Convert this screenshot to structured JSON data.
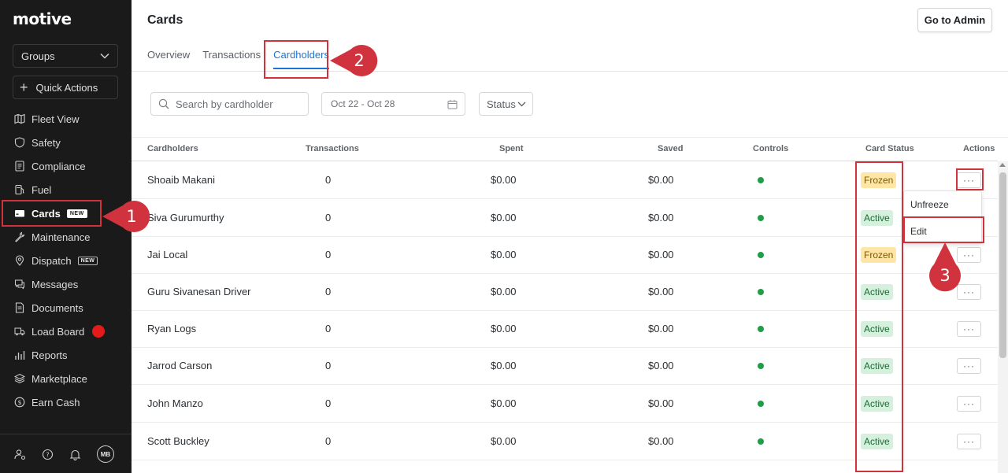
{
  "sidebar": {
    "logo": "motive",
    "groups_label": "Groups",
    "quick_actions_label": "Quick Actions",
    "items": [
      {
        "label": "Fleet View",
        "icon": "map-icon"
      },
      {
        "label": "Safety",
        "icon": "shield-icon"
      },
      {
        "label": "Compliance",
        "icon": "document-icon"
      },
      {
        "label": "Fuel",
        "icon": "fuel-icon"
      },
      {
        "label": "Cards",
        "icon": "card-icon",
        "badge": "NEW",
        "active": true
      },
      {
        "label": "Maintenance",
        "icon": "wrench-icon"
      },
      {
        "label": "Dispatch",
        "icon": "location-pin-icon",
        "badge": "NEW"
      },
      {
        "label": "Messages",
        "icon": "chat-icon"
      },
      {
        "label": "Documents",
        "icon": "file-icon"
      },
      {
        "label": "Load Board",
        "icon": "truck-icon",
        "notification_dot": true
      },
      {
        "label": "Reports",
        "icon": "chart-icon"
      },
      {
        "label": "Marketplace",
        "icon": "layers-icon"
      },
      {
        "label": "Earn Cash",
        "icon": "dollar-icon"
      }
    ],
    "avatar_initials": "MB"
  },
  "header": {
    "title": "Cards",
    "admin_button": "Go to Admin"
  },
  "tabs": [
    {
      "label": "Overview"
    },
    {
      "label": "Transactions"
    },
    {
      "label": "Cardholders",
      "active": true
    }
  ],
  "filters": {
    "search_placeholder": "Search by cardholder",
    "date_range": "Oct 22 - Oct 28",
    "status_label": "Status"
  },
  "table": {
    "columns": [
      "Cardholders",
      "Transactions",
      "Spent",
      "Saved",
      "Controls",
      "Card Status",
      "Actions"
    ],
    "rows": [
      {
        "name": "Shoaib Makani",
        "transactions": "0",
        "spent": "$0.00",
        "saved": "$0.00",
        "status": "Frozen"
      },
      {
        "name": "Siva Gurumurthy",
        "transactions": "0",
        "spent": "$0.00",
        "saved": "$0.00",
        "status": "Active"
      },
      {
        "name": "Jai Local",
        "transactions": "0",
        "spent": "$0.00",
        "saved": "$0.00",
        "status": "Frozen"
      },
      {
        "name": "Guru Sivanesan Driver",
        "transactions": "0",
        "spent": "$0.00",
        "saved": "$0.00",
        "status": "Active"
      },
      {
        "name": "Ryan Logs",
        "transactions": "0",
        "spent": "$0.00",
        "saved": "$0.00",
        "status": "Active"
      },
      {
        "name": "Jarrod Carson",
        "transactions": "0",
        "spent": "$0.00",
        "saved": "$0.00",
        "status": "Active"
      },
      {
        "name": "John Manzo",
        "transactions": "0",
        "spent": "$0.00",
        "saved": "$0.00",
        "status": "Active"
      },
      {
        "name": "Scott Buckley",
        "transactions": "0",
        "spent": "$0.00",
        "saved": "$0.00",
        "status": "Active"
      }
    ],
    "more_label": "···"
  },
  "actions_menu": {
    "items": [
      "Unfreeze",
      "Edit"
    ]
  },
  "annotations": {
    "step1": "1",
    "step2": "2",
    "step3": "3",
    "color": "#d0333d"
  },
  "colors": {
    "accent": "#1b74d8",
    "sidebar_bg": "#1a1a1a",
    "active_badge_bg": "#d5f0dc",
    "frozen_badge_bg": "#ffe6a6",
    "control_dot": "#1f9d48"
  }
}
